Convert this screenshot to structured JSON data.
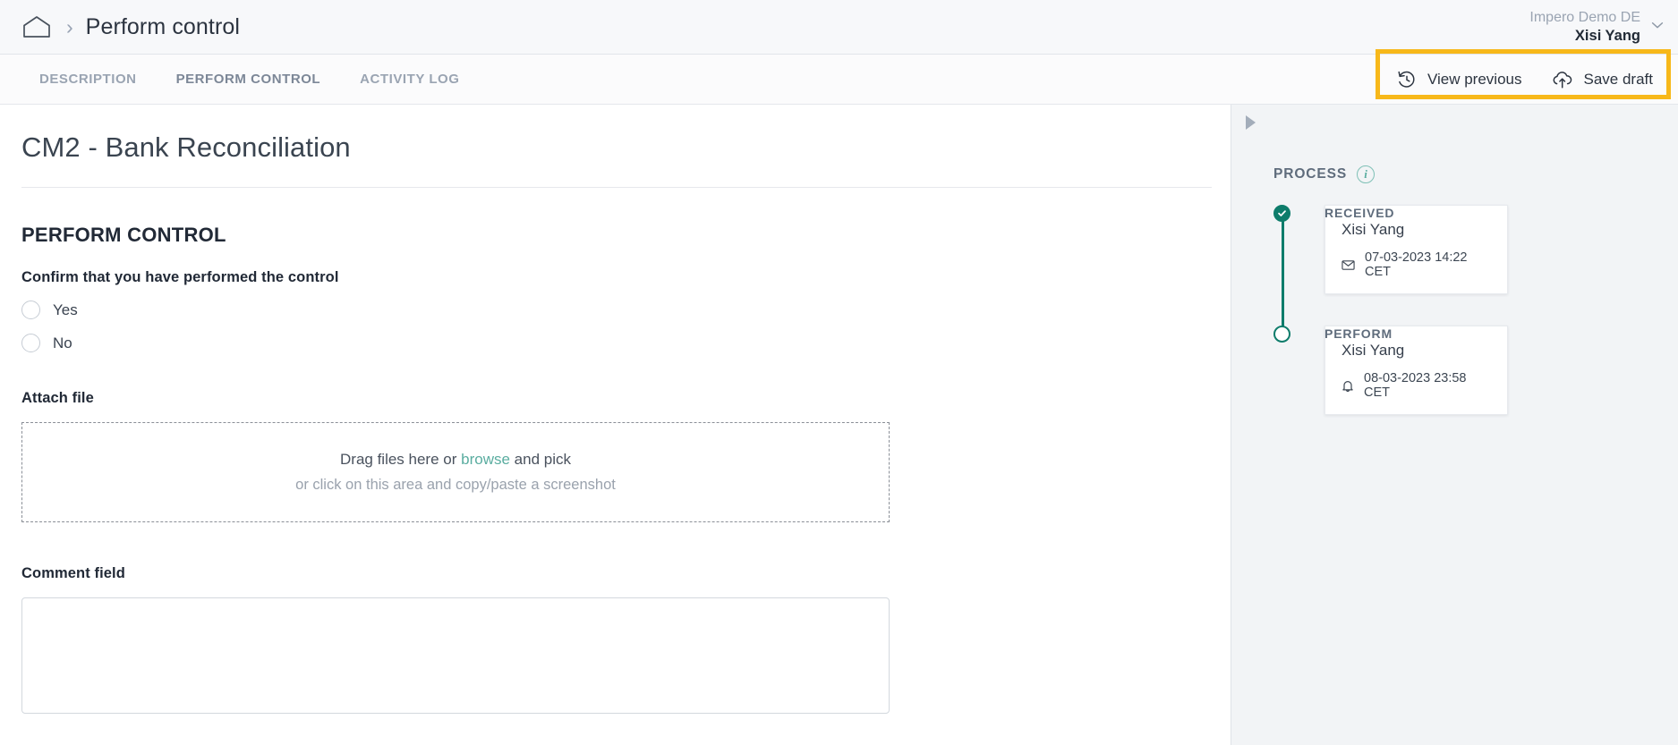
{
  "header": {
    "home_icon": "home-icon",
    "separator": "›",
    "breadcrumb_title": "Perform control",
    "tenant": "Impero Demo DE",
    "username": "Xisi Yang",
    "caret_icon": "chevron-down-icon"
  },
  "tabbar": {
    "tabs": [
      {
        "label": "DESCRIPTION",
        "active": false
      },
      {
        "label": "PERFORM CONTROL",
        "active": true
      },
      {
        "label": "ACTIVITY LOG",
        "active": false
      }
    ],
    "actions": [
      {
        "label": "View previous",
        "icon": "history-rotate-left-icon"
      },
      {
        "label": "Save draft",
        "icon": "cloud-upload-icon"
      }
    ],
    "highlight_color": "#f7b81a"
  },
  "main": {
    "document_title": "CM2 - Bank Reconciliation",
    "section_heading": "PERFORM CONTROL",
    "confirm_label": "Confirm that you have performed the control",
    "radio_options": [
      {
        "label": "Yes",
        "selected": false
      },
      {
        "label": "No",
        "selected": false
      }
    ],
    "attach_label": "Attach file",
    "dropzone": {
      "line1_prefix": "Drag files here or ",
      "line1_link": "browse",
      "line1_suffix": " and pick",
      "line2": "or click on this area and copy/paste a screenshot",
      "link_color": "#5aada0"
    },
    "comment_label": "Comment field",
    "comment_value": "",
    "comment_placeholder": ""
  },
  "right_panel": {
    "collapse_icon": "expand-arrow-icon",
    "process_title": "PROCESS",
    "info_icon": "info-circle-icon",
    "accent_color": "#0e7c6b",
    "steps": [
      {
        "label": "RECEIVED",
        "state": "done",
        "card": {
          "name": "Xisi Yang",
          "meta_icon": "envelope-icon",
          "meta_text": "07-03-2023 14:22 CET"
        }
      },
      {
        "label": "PERFORM",
        "state": "current",
        "card": {
          "name": "Xisi Yang",
          "meta_icon": "bell-icon",
          "meta_text": "08-03-2023 23:58 CET"
        }
      }
    ]
  }
}
